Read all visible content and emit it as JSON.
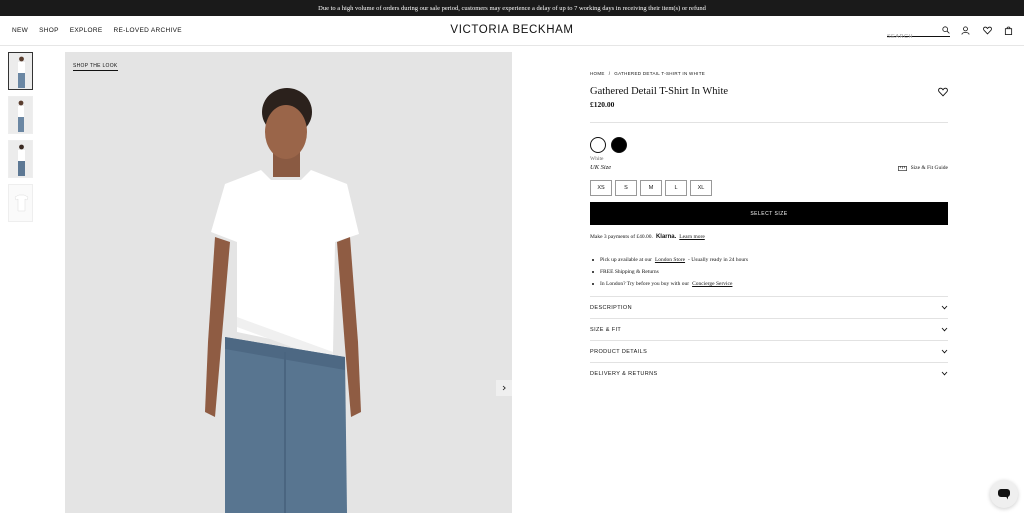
{
  "banner": {
    "text": "Due to a high volume of orders during our sale period, customers may experience a delay of up to 7 working days in receiving their item(s) or refund"
  },
  "header": {
    "nav": [
      "NEW",
      "SHOP",
      "EXPLORE",
      "RE-LOVED ARCHIVE"
    ],
    "logo": "VICTORIA BECKHAM",
    "search_placeholder": "SEARCH"
  },
  "gallery": {
    "shop_the_look": "SHOP THE LOOK",
    "thumbnails": 4,
    "active_thumbnail": 1
  },
  "product": {
    "breadcrumb": [
      "HOME",
      "/",
      "GATHERED DETAIL T-SHIRT IN WHITE"
    ],
    "title": "Gathered Detail T-Shirt In White",
    "price": "£120.00",
    "colors": [
      "#ffffff",
      "#000000"
    ],
    "selected_color": "White",
    "size_label": "UK Size",
    "fit_guide": "Size & Fit Guide",
    "sizes": [
      "XS",
      "S",
      "M",
      "L",
      "XL"
    ],
    "select_button": "SELECT SIZE",
    "klarna": {
      "text": "Make 3 payments of £40.00.",
      "brand": "Klarna.",
      "link": "Learn more"
    },
    "perks": [
      {
        "text": "Pick up available at our",
        "link": "London Store",
        "after": "- Usually ready in 24 hours"
      },
      {
        "text": "FREE Shipping & Returns",
        "link": "",
        "after": ""
      },
      {
        "text": "In London? Try before you buy with our",
        "link": "Concierge Service",
        "after": ""
      }
    ],
    "accordions": [
      "DESCRIPTION",
      "SIZE & FIT",
      "PRODUCT DETAILS",
      "DELIVERY & RETURNS"
    ]
  }
}
